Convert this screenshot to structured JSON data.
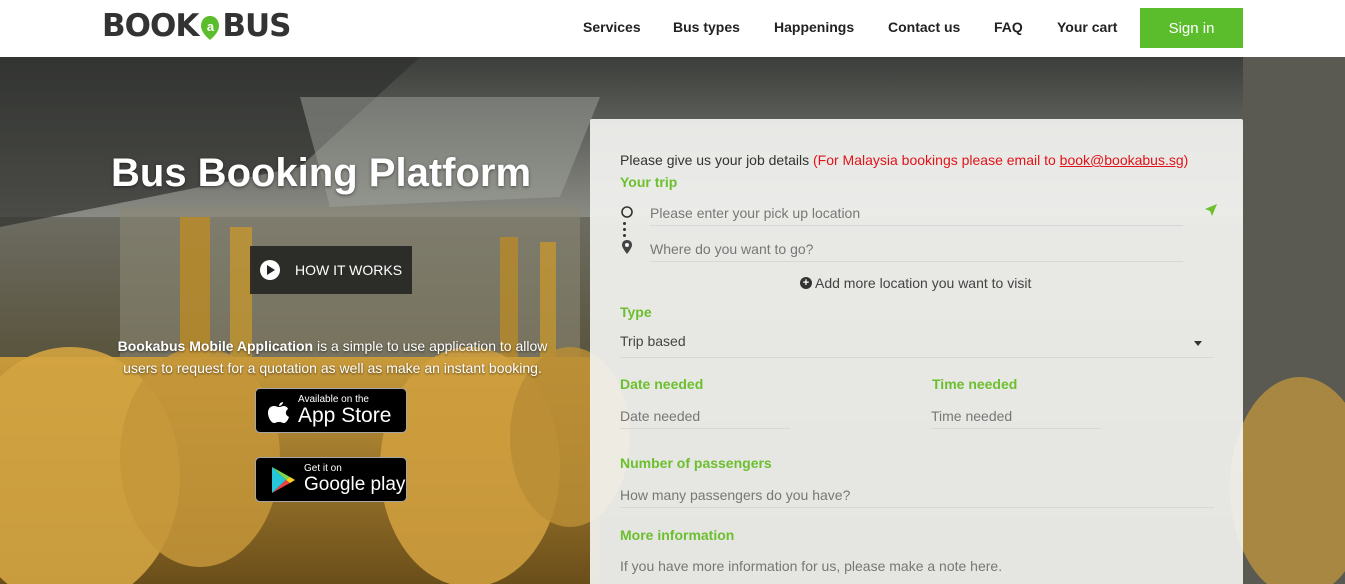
{
  "header": {
    "logo_text_left": "BOOK",
    "logo_text_right": "BUS",
    "nav": [
      {
        "label": "Services"
      },
      {
        "label": "Bus types"
      },
      {
        "label": "Happenings"
      },
      {
        "label": "Contact us"
      },
      {
        "label": "FAQ"
      },
      {
        "label": "Your cart"
      }
    ],
    "signin_label": "Sign in"
  },
  "hero": {
    "title": "Bus Booking Platform",
    "how_label": "HOW IT WORKS",
    "desc_bold": "Bookabus Mobile Application",
    "desc_rest": " is a simple to use application to allow users to request for a quotation as well as make an instant booking.",
    "appstore_small": "Available on the",
    "appstore_big": "App Store",
    "gplay_small": "Get it on",
    "gplay_big": "Google play"
  },
  "form": {
    "intro": "Please give us your job details ",
    "intro_red": "(For Malaysia bookings please email to ",
    "intro_email": "book@bookabus.sg",
    "intro_close": ")",
    "your_trip_label": "Your trip",
    "pickup_placeholder": "Please enter your pick up location",
    "destination_placeholder": "Where do you want to go?",
    "add_location": "Add more location you want to visit",
    "type_label": "Type",
    "type_value": "Trip based",
    "date_label": "Date needed",
    "date_placeholder": "Date needed",
    "time_label": "Time needed",
    "time_placeholder": "Time needed",
    "passengers_label": "Number of passengers",
    "passengers_placeholder": "How many passengers do you have?",
    "more_label": "More information",
    "more_placeholder": "If you have more information for us, please make a note here."
  },
  "colors": {
    "accent_green": "#5bbd2b",
    "label_green": "#6cbf2e",
    "notice_red": "#e0131a"
  }
}
